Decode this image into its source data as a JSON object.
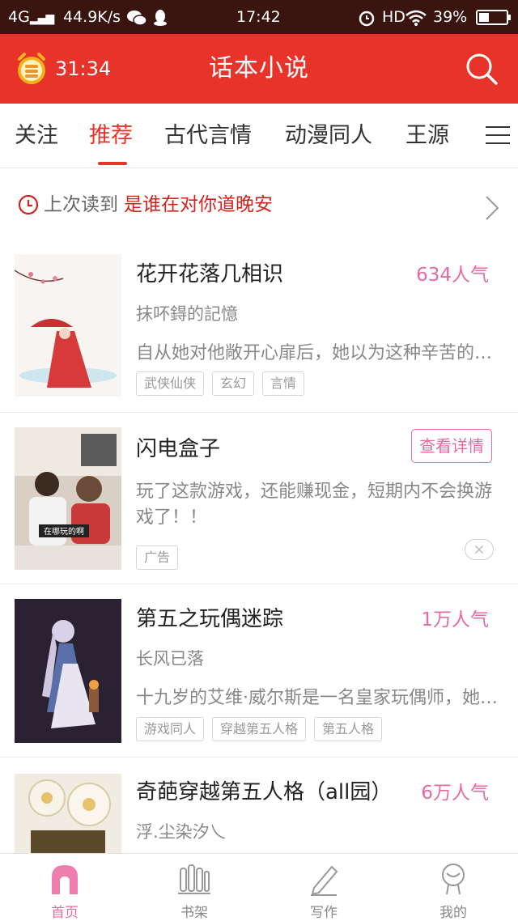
{
  "status_bar": {
    "network": "4G",
    "speed": "44.9K/s",
    "time": "17:42",
    "hd": "HD",
    "battery": "39%",
    "battery_level": 0.39
  },
  "header": {
    "timer": "31:34",
    "title": "话本小说",
    "bg_color": "#e8332a"
  },
  "tabs": [
    {
      "label": "关注",
      "active": false
    },
    {
      "label": "推荐",
      "active": true
    },
    {
      "label": "古代言情",
      "active": false
    },
    {
      "label": "动漫同人",
      "active": false
    },
    {
      "label": "王源",
      "active": false
    }
  ],
  "last_read": {
    "label": "上次读到",
    "title": "是谁在对你道晚安"
  },
  "feed": [
    {
      "title": "花开花落几相识",
      "popularity": "634人气",
      "author": "抹吥鍀的記憶",
      "description": "自从她对他敞开心扉后，她以为这种辛苦的日子终于结束了",
      "tags": [
        "武侠仙侠",
        "玄幻",
        "言情"
      ]
    },
    {
      "title": "闪电盒子",
      "detail_button": "查看详情",
      "description": "玩了这款游戏，还能赚现金，短期内不会换游戏了！！",
      "ad_badge": "广告",
      "image_caption": "在哪玩的啊"
    },
    {
      "title": "第五之玩偶迷踪",
      "popularity": "1万人气",
      "author": "长风已落",
      "description": "十九岁的艾维·威尔斯是一名皇家玩偶师，她的人生",
      "tags": [
        "游戏同人",
        "穿越第五人格",
        "第五人格"
      ]
    },
    {
      "title": "奇葩穿越第五人格（all园）",
      "popularity": "6万人气",
      "author": "浮.尘染汐乀"
    }
  ],
  "bottom_nav": [
    {
      "label": "首页",
      "icon": "home-icon",
      "active": true
    },
    {
      "label": "书架",
      "icon": "bookshelf-icon",
      "active": false
    },
    {
      "label": "写作",
      "icon": "pen-icon",
      "active": false
    },
    {
      "label": "我的",
      "icon": "profile-icon",
      "active": false
    }
  ],
  "colors": {
    "accent": "#e8332a",
    "popularity": "#e66aa3",
    "status_bar": "#3a1510"
  }
}
